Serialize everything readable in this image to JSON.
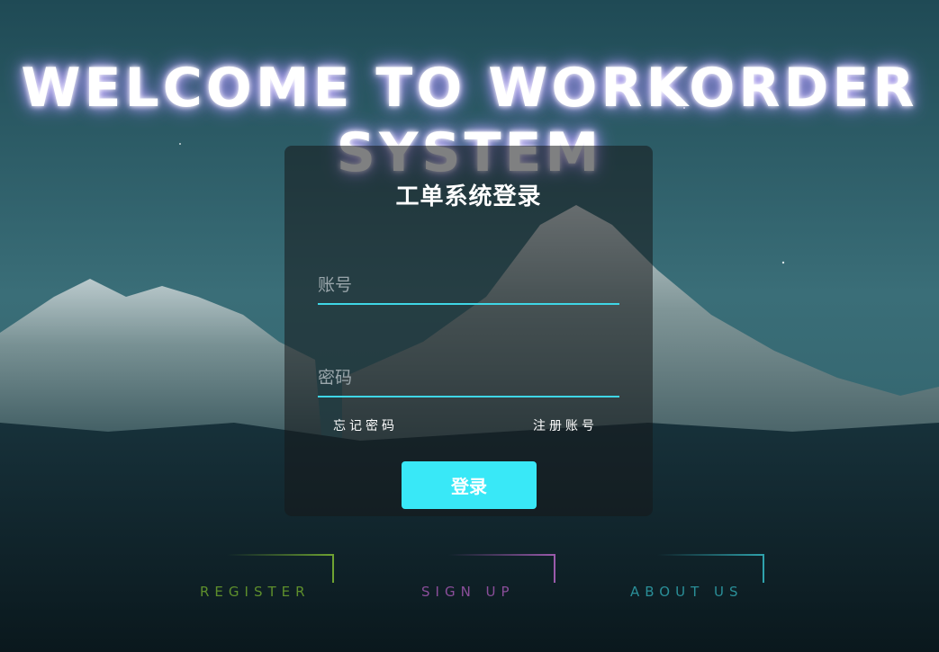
{
  "hero": {
    "line1": "WELCOME TO WORKORDER",
    "line2": "SYSTEM"
  },
  "login": {
    "title": "工单系统登录",
    "account_placeholder": "账号",
    "password_placeholder": "密码",
    "forgot_label": "忘记密码",
    "register_label": "注册账号",
    "submit_label": "登录"
  },
  "footer": {
    "links": [
      {
        "label": "REGISTER",
        "color": "#5e8f2c"
      },
      {
        "label": "SIGN UP",
        "color": "#8a4e9a"
      },
      {
        "label": "ABOUT US",
        "color": "#2a8f98"
      }
    ]
  },
  "colors": {
    "accent": "#39e8f7",
    "input_underline": "#3fd6e6"
  }
}
